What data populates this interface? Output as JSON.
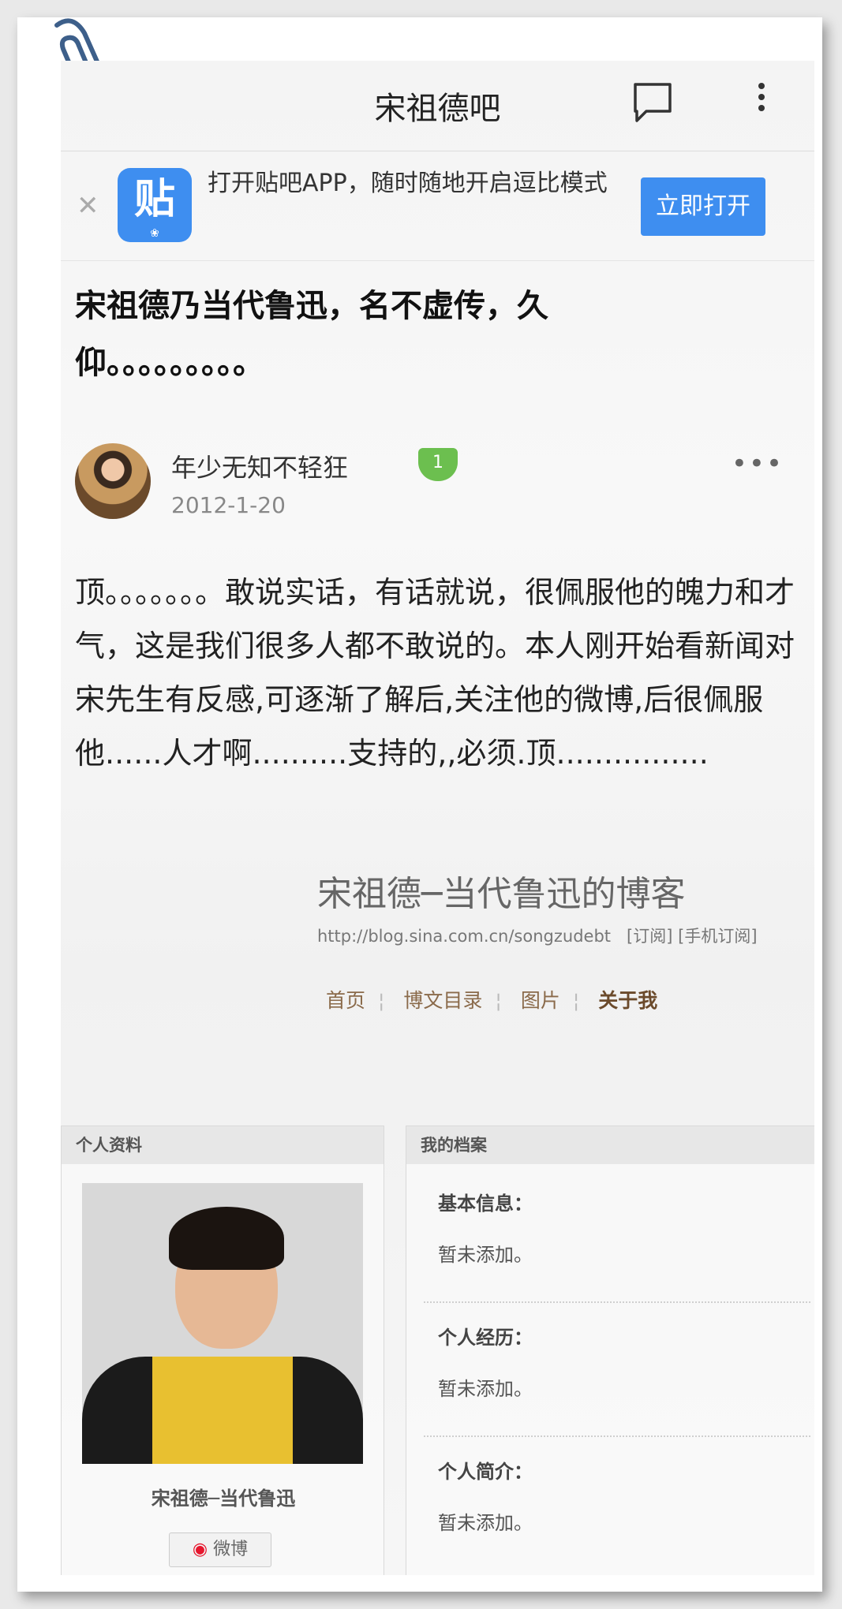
{
  "header": {
    "title": "宋祖德吧"
  },
  "banner": {
    "text": "打开贴吧APP，随时随地开启逗比模式",
    "open_label": "立即打开",
    "logo_char": "贴"
  },
  "post": {
    "title": "宋祖德乃当代鲁迅，名不虚传，久仰。。。。。。。。。",
    "author": "年少无知不轻狂",
    "level": "1",
    "date": "2012-1-20",
    "content": "顶。。。。。。。敢说实话，有话就说，很佩服他的魄力和才气，这是我们很多人都不敢说的。本人刚开始看新闻对宋先生有反感,可逐渐了解后,关注他的微博,后很佩服他......人才啊..........支持的,,必须.顶................"
  },
  "blog": {
    "title": "宋祖德─当代鲁迅的博客",
    "url": "http://blog.sina.com.cn/songzudebt",
    "subscribe": "[订阅]",
    "mobile_subscribe": "[手机订阅]",
    "nav": [
      "首页",
      "博文目录",
      "图片",
      "关于我"
    ]
  },
  "profile": {
    "header": "个人资料",
    "caption": "宋祖德─当代鲁迅",
    "weibo_label": "微博"
  },
  "archive": {
    "header": "我的档案",
    "sections": [
      {
        "label": "基本信息：",
        "value": "暂未添加。"
      },
      {
        "label": "个人经历：",
        "value": "暂未添加。"
      },
      {
        "label": "个人简介：",
        "value": "暂未添加。"
      }
    ]
  }
}
